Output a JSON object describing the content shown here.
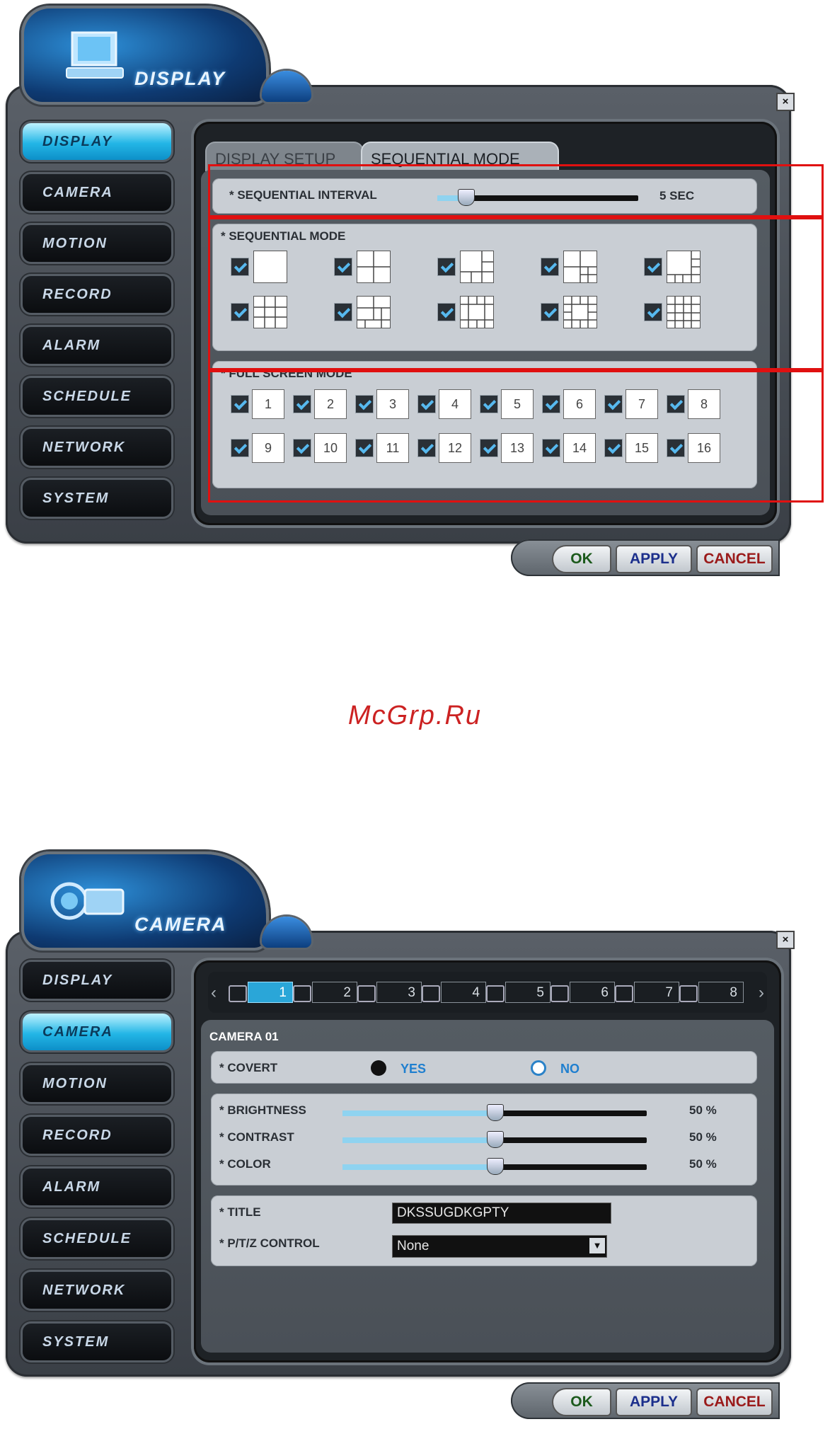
{
  "display_screen": {
    "header_title": "DISPLAY",
    "menu": [
      "DISPLAY",
      "CAMERA",
      "MOTION",
      "RECORD",
      "ALARM",
      "SCHEDULE",
      "NETWORK",
      "SYSTEM"
    ],
    "active_menu": "DISPLAY",
    "tabs": [
      "DISPLAY SETUP",
      "SEQUENTIAL MODE"
    ],
    "active_tab": "SEQUENTIAL MODE",
    "sequential_interval": {
      "label": "* SEQUENTIAL INTERVAL",
      "value_text": "5 SEC",
      "slider_fraction": 0.14
    },
    "sequential_mode": {
      "label": "* SEQUENTIAL MODE",
      "layouts_checked": [
        true,
        true,
        true,
        true,
        true,
        true,
        true,
        true,
        true,
        true
      ]
    },
    "full_screen_mode": {
      "label": "* FULL SCREEN MODE",
      "channels": [
        "1",
        "2",
        "3",
        "4",
        "5",
        "6",
        "7",
        "8",
        "9",
        "10",
        "11",
        "12",
        "13",
        "14",
        "15",
        "16"
      ]
    },
    "buttons": {
      "ok": "OK",
      "apply": "APPLY",
      "cancel": "CANCEL"
    },
    "close": "×"
  },
  "watermark": "McGrp.Ru",
  "camera_screen": {
    "header_title": "CAMERA",
    "menu": [
      "DISPLAY",
      "CAMERA",
      "MOTION",
      "RECORD",
      "ALARM",
      "SCHEDULE",
      "NETWORK",
      "SYSTEM"
    ],
    "active_menu": "CAMERA",
    "camera_tabs": [
      "1",
      "2",
      "3",
      "4",
      "5",
      "6",
      "7",
      "8"
    ],
    "active_camera_tab": "1",
    "camera_name": "CAMERA 01",
    "covert": {
      "label": "* COVERT",
      "yes": "YES",
      "no": "NO",
      "selected": "YES"
    },
    "brightness": {
      "label": "* BRIGHTNESS",
      "value_text": "50 %",
      "slider_fraction": 0.5
    },
    "contrast": {
      "label": "* CONTRAST",
      "value_text": "50 %",
      "slider_fraction": 0.5
    },
    "color": {
      "label": "* COLOR",
      "value_text": "50 %",
      "slider_fraction": 0.5
    },
    "title": {
      "label": "* TITLE",
      "value": "DKSSUGDKGPTY"
    },
    "ptz": {
      "label": "* P/T/Z CONTROL",
      "value": "None"
    },
    "buttons": {
      "ok": "OK",
      "apply": "APPLY",
      "cancel": "CANCEL"
    },
    "close": "×",
    "accent_color": "#2aa6d8"
  }
}
